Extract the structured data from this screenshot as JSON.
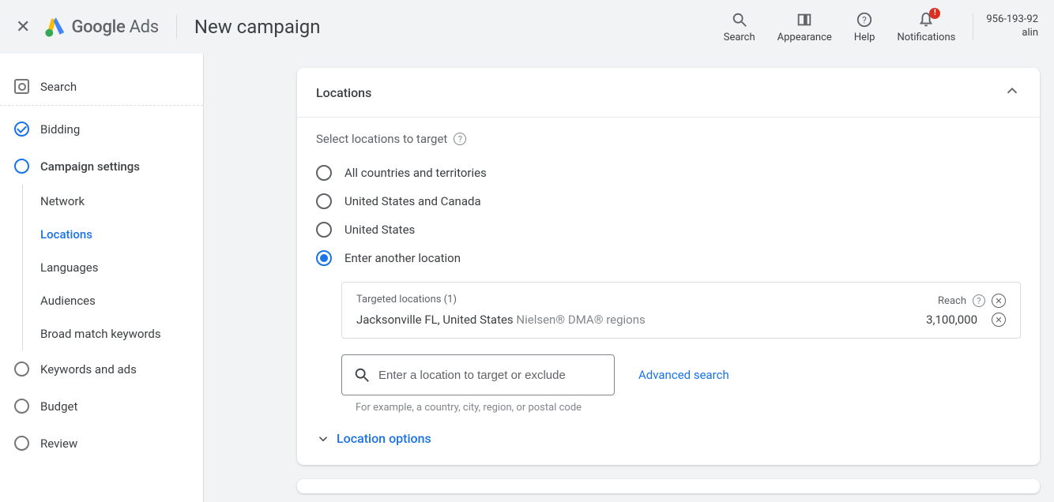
{
  "header": {
    "brand_google": "Google",
    "brand_ads": "Ads",
    "page_title": "New campaign",
    "search": "Search",
    "appearance": "Appearance",
    "help": "Help",
    "notifications": "Notifications",
    "account_id": "956-193-92",
    "account_user": "alin"
  },
  "sidebar": {
    "search": "Search",
    "bidding": "Bidding",
    "campaign_settings": "Campaign settings",
    "sub_network": "Network",
    "sub_locations": "Locations",
    "sub_languages": "Languages",
    "sub_audiences": "Audiences",
    "sub_broad": "Broad match keywords",
    "keywords_ads": "Keywords and ads",
    "budget": "Budget",
    "review": "Review"
  },
  "card": {
    "title": "Locations",
    "select_label": "Select locations to target",
    "opt_all": "All countries and territories",
    "opt_usca": "United States and Canada",
    "opt_us": "United States",
    "opt_other": "Enter another location",
    "targeted_label": "Targeted locations (1)",
    "reach_label": "Reach",
    "loc_name": "Jacksonville FL, United States",
    "loc_type": "Nielsen® DMA® regions",
    "loc_reach": "3,100,000",
    "search_placeholder": "Enter a location to target or exclude",
    "advanced_search": "Advanced search",
    "example_hint": "For example, a country, city, region, or postal code",
    "location_options": "Location options"
  }
}
